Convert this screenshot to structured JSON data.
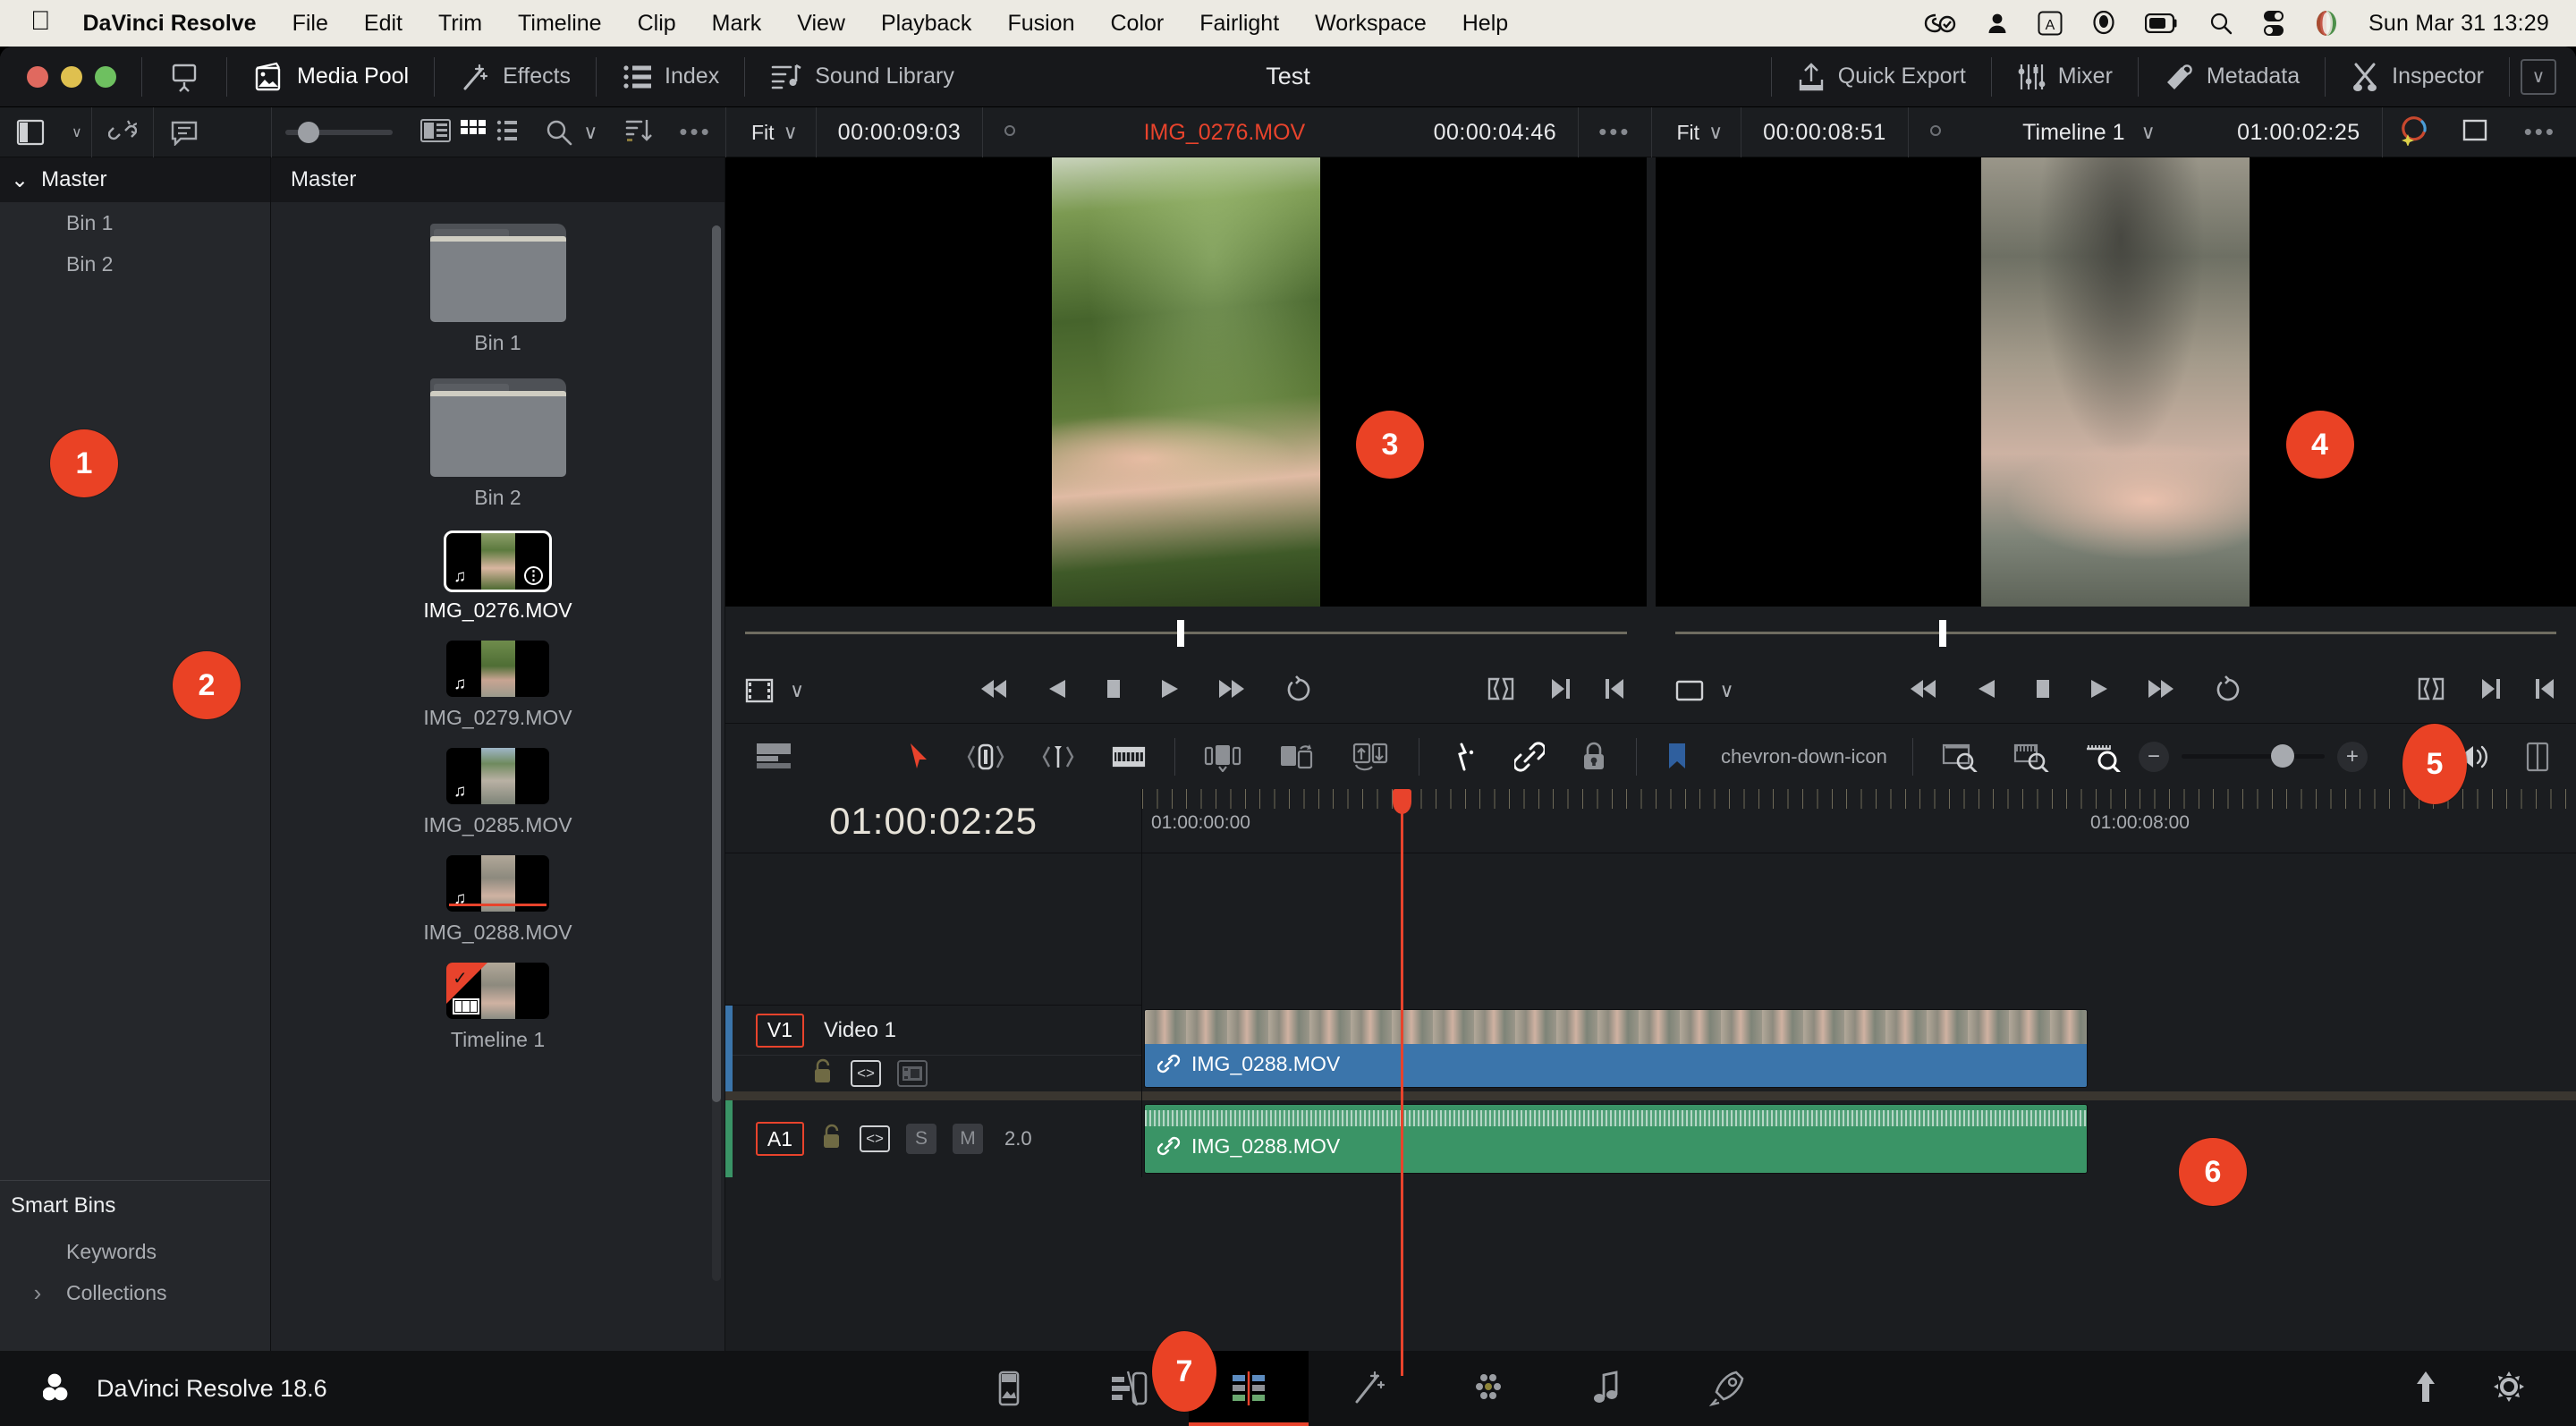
{
  "macbar": {
    "apple_icon": "apple-logo",
    "app_name": "DaVinci Resolve",
    "menus": [
      "File",
      "Edit",
      "Trim",
      "Timeline",
      "Clip",
      "Mark",
      "View",
      "Playback",
      "Fusion",
      "Color",
      "Fairlight",
      "Workspace",
      "Help"
    ],
    "status_icons": [
      "screen-recording-icon",
      "user-account-icon",
      "keyboard-input-a-icon",
      "microphone-icon",
      "battery-icon",
      "spotlight-search-icon",
      "control-center-icon",
      "siri-icon"
    ],
    "clock": "Sun Mar 31  13:29"
  },
  "toolbar": {
    "window_title": "Test",
    "left_items": [
      {
        "label": "Media Pool",
        "icon": "media-pool-icon",
        "active": true
      },
      {
        "label": "Effects",
        "icon": "effects-wand-icon",
        "active": false
      },
      {
        "label": "Index",
        "icon": "index-list-icon",
        "active": false
      },
      {
        "label": "Sound Library",
        "icon": "sound-library-icon",
        "active": false
      }
    ],
    "screen_icon": "fullscreen-toggle-icon",
    "right_items": [
      {
        "label": "Quick Export",
        "icon": "quick-export-icon"
      },
      {
        "label": "Mixer",
        "icon": "mixer-icon"
      },
      {
        "label": "Metadata",
        "icon": "metadata-icon"
      },
      {
        "label": "Inspector",
        "icon": "inspector-icon"
      }
    ],
    "collapse_chevron": "∨"
  },
  "row2": {
    "left": {
      "panel_toggle_icon": "panel-layout-icon",
      "chevron": "∨",
      "unlink_icon": "unlink-clips-icon",
      "caption_icon": "subtitles-icon",
      "thumb_size_label": "thumbnail-size-slider",
      "view_list_icon": "list-view-icon",
      "view_grid_icon": "thumbnail-view-icon",
      "view_detail_icon": "detail-view-icon",
      "search_icon": "search-icon",
      "search_chevron": "∨",
      "sort_icon": "sort-order-icon",
      "more_icon": "more-options-icon"
    },
    "source_viewer": {
      "fit_label": "Fit",
      "fit_chevron": "∨",
      "duration": "00:00:09:03",
      "marker_icon": "marker-dot-icon",
      "clip_name": "IMG_0276.MOV",
      "timecode": "00:00:04:46",
      "more_icon": "more-options-icon"
    },
    "timeline_viewer": {
      "fit_label": "Fit",
      "fit_chevron": "∨",
      "duration": "00:00:08:51",
      "marker_icon": "marker-dot-icon",
      "timeline_name": "Timeline 1",
      "name_chevron": "∨",
      "timecode": "01:00:02:25",
      "color_icon": "enhance-color-icon",
      "frame_icon": "viewer-frame-icon",
      "more_icon": "more-options-icon"
    }
  },
  "sidebar": {
    "master": {
      "label": "Master",
      "chevron": "⌄"
    },
    "bins": [
      {
        "label": "Bin 1"
      },
      {
        "label": "Bin 2"
      }
    ],
    "smart_bins_title": "Smart Bins",
    "smart_items": [
      {
        "label": "Keywords",
        "arrow": ""
      },
      {
        "label": "Collections",
        "arrow": "›"
      }
    ]
  },
  "media_pool": {
    "header": "Master",
    "items": [
      {
        "name": "Bin 1",
        "type": "folder"
      },
      {
        "name": "Bin 2",
        "type": "folder"
      },
      {
        "name": "IMG_0276.MOV",
        "type": "clip",
        "selected": true,
        "audio": true,
        "info": true
      },
      {
        "name": "IMG_0279.MOV",
        "type": "clip",
        "selected": false,
        "audio": true
      },
      {
        "name": "IMG_0285.MOV",
        "type": "clip",
        "selected": false,
        "audio": true
      },
      {
        "name": "IMG_0288.MOV",
        "type": "clip",
        "selected": false,
        "audio": true,
        "used": true
      },
      {
        "name": "Timeline 1",
        "type": "timeline",
        "flagged": true
      }
    ]
  },
  "viewers": {
    "source": {
      "name": "source-viewer",
      "scrub_position_pct": 49
    },
    "timeline": {
      "name": "timeline-viewer",
      "scrub_position_pct": 30
    },
    "transport": {
      "format_icon": "frame-format-icon",
      "chevron": "∨",
      "jump_start_icon": "jump-to-start-icon",
      "reverse_icon": "play-reverse-icon",
      "stop_icon": "stop-icon",
      "play_icon": "play-icon",
      "jump_end_icon": "jump-to-end-icon",
      "loop_icon": "loop-icon",
      "mark_clip_icon": "mark-clip-icon",
      "mark_out_icon": "mark-out-icon",
      "mark_in_icon": "mark-in-icon"
    }
  },
  "timeline_toolbar": {
    "buttons": [
      {
        "icon": "timeline-view-options-icon",
        "name": "timeline-view-options"
      },
      {
        "icon": "selection-arrow-icon",
        "name": "selection-mode",
        "active": true
      },
      {
        "icon": "trim-edit-icon",
        "name": "trim-edit-mode"
      },
      {
        "icon": "dynamic-trim-icon",
        "name": "dynamic-trim-mode"
      },
      {
        "icon": "razor-icon",
        "name": "blade-edit-mode"
      },
      {
        "icon": "insert-clip-icon",
        "name": "insert-clip"
      },
      {
        "icon": "overwrite-clip-icon",
        "name": "overwrite-clip"
      },
      {
        "icon": "replace-clip-icon",
        "name": "replace-clip"
      },
      {
        "icon": "snapping-icon",
        "name": "snapping-toggle"
      },
      {
        "icon": "link-clips-icon",
        "name": "link-clips-toggle"
      },
      {
        "icon": "lock-track-icon",
        "name": "lock-tracks-toggle"
      },
      {
        "icon": "flag-marker-icon",
        "name": "add-marker"
      },
      {
        "icon": "chevron-down-icon",
        "name": "marker-color-dropdown"
      },
      {
        "icon": "zoom-fit-icon",
        "name": "zoom-to-fit"
      },
      {
        "icon": "zoom-detail-icon",
        "name": "detail-zoom"
      },
      {
        "icon": "zoom-custom-icon",
        "name": "custom-zoom",
        "active": true
      }
    ],
    "zoom_minus": "−",
    "zoom_plus": "+",
    "audio_icon": "audio-volume-icon",
    "panel_icon": "panel-layout-icon"
  },
  "timeline": {
    "current_timecode": "01:00:02:25",
    "ruler_labels": [
      "01:00:00:00",
      "01:00:08:00"
    ],
    "tracks": [
      {
        "id": "V1",
        "name": "Video 1",
        "kind": "video",
        "lock_icon": "unlock-icon",
        "auto_select_icon": "auto-select-icon",
        "enable_icon": "track-enable-icon",
        "clip": {
          "name": "IMG_0288.MOV",
          "link_icon": "link-icon"
        }
      },
      {
        "id": "A1",
        "name": "",
        "kind": "audio",
        "lock_icon": "unlock-icon",
        "auto_select_icon": "auto-select-icon",
        "solo_label": "S",
        "mute_label": "M",
        "gain": "2.0",
        "clip": {
          "name": "IMG_0288.MOV",
          "link_icon": "link-icon"
        }
      }
    ]
  },
  "bottombar": {
    "brand_icon": "davinci-resolve-logo",
    "brand": "DaVinci Resolve 18.6",
    "pages": [
      {
        "name": "media-page",
        "icon": "media-page-icon",
        "active": false
      },
      {
        "name": "cut-page",
        "icon": "cut-page-icon",
        "active": false
      },
      {
        "name": "edit-page",
        "icon": "edit-page-icon",
        "active": true
      },
      {
        "name": "fusion-page",
        "icon": "fusion-page-icon",
        "active": false
      },
      {
        "name": "color-page",
        "icon": "color-page-icon",
        "active": false
      },
      {
        "name": "fairlight-page",
        "icon": "fairlight-page-icon",
        "active": false
      },
      {
        "name": "deliver-page",
        "icon": "deliver-page-icon",
        "active": false
      }
    ],
    "right_icons": [
      {
        "name": "project-manager-icon"
      },
      {
        "name": "project-settings-gear-icon"
      }
    ]
  },
  "annotations": {
    "accent_color": "#ea4225",
    "badges": [
      {
        "label": "1",
        "target": "sidebar-bins"
      },
      {
        "label": "2",
        "target": "media-pool-grid"
      },
      {
        "label": "3",
        "target": "source-viewer"
      },
      {
        "label": "4",
        "target": "timeline-viewer"
      },
      {
        "label": "5",
        "target": "timeline-toolbar-markers"
      },
      {
        "label": "6",
        "target": "timeline-tracks"
      },
      {
        "label": "7",
        "target": "page-switcher"
      }
    ]
  }
}
